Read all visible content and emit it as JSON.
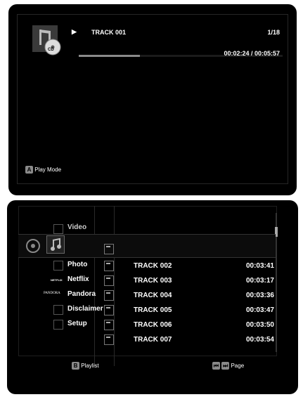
{
  "now_playing": {
    "track_title": "TRACK 001",
    "track_index": "1/18",
    "time": "00:02:24 / 00:05:57",
    "progress_fraction": 0.3,
    "disc_label": "CD"
  },
  "top_footer": {
    "key": "A",
    "label": "Play Mode"
  },
  "sidebar": {
    "items": [
      {
        "label": "Video"
      },
      {
        "label": "Photo"
      },
      {
        "label": "Netflix",
        "logo_text": "NETFLIX"
      },
      {
        "label": "Pandora",
        "logo_text": "PANDORA"
      },
      {
        "label": "Disclaimer"
      },
      {
        "label": "Setup"
      }
    ]
  },
  "tracks": [
    {
      "name": "TRACK 002",
      "duration": "00:03:41"
    },
    {
      "name": "TRACK 003",
      "duration": "00:03:17"
    },
    {
      "name": "TRACK 004",
      "duration": "00:03:36"
    },
    {
      "name": "TRACK 005",
      "duration": "00:03:47"
    },
    {
      "name": "TRACK 006",
      "duration": "00:03:50"
    },
    {
      "name": "TRACK 007",
      "duration": "00:03:54"
    }
  ],
  "bottom_footer": {
    "playlist_key": "B",
    "playlist_label": "Playlist",
    "page_label": "Page"
  }
}
